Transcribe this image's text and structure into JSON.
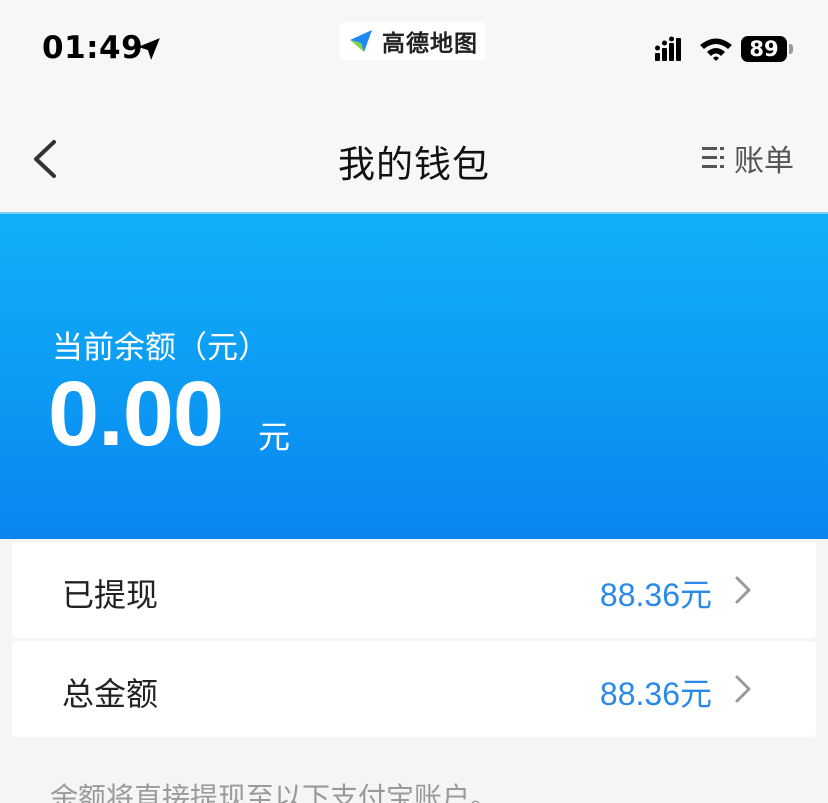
{
  "status_bar": {
    "time": "01:49",
    "app_name": "高德地图",
    "battery": "89"
  },
  "nav": {
    "title": "我的钱包",
    "bill_label": "账单"
  },
  "balance": {
    "label": "当前余额（元）",
    "amount": "0.00",
    "unit": "元"
  },
  "rows": [
    {
      "label": "已提现",
      "value": "88.36元"
    },
    {
      "label": "总金额",
      "value": "88.36元"
    }
  ],
  "note": "余额将直接提现至以下支付宝账户。",
  "colors": {
    "accent": "#2a8ae6",
    "card_top": "#12aff7",
    "card_bottom": "#0985f2"
  },
  "icons": [
    "location-arrow-icon",
    "app-logo-icon",
    "signal-icon",
    "wifi-icon",
    "back-icon",
    "list-icon",
    "chevron-right-icon"
  ]
}
